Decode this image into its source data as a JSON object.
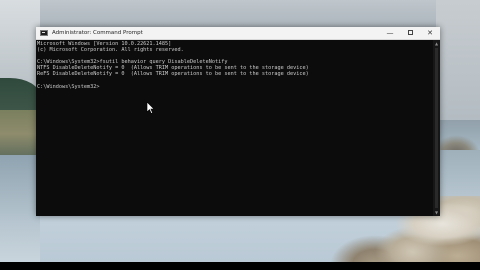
{
  "window": {
    "title": "Administrator: Command Prompt",
    "app_icon": "command-prompt-icon",
    "controls": {
      "minimize": "—",
      "close": "✕"
    }
  },
  "console": {
    "lines": [
      "Microsoft Windows [Version 10.0.22621.1485]",
      "(c) Microsoft Corporation. All rights reserved.",
      "",
      "C:\\Windows\\System32>fsutil behavior query DisableDeleteNotify",
      "NTFS DisableDeleteNotify = 0  (Allows TRIM operations to be sent to the storage device)",
      "ReFS DisableDeleteNotify = 0  (Allows TRIM operations to be sent to the storage device)",
      "",
      "C:\\Windows\\System32>"
    ],
    "text_color": "#cccccc",
    "background_color": "#0c0c0c"
  },
  "scrollbar": {
    "up_arrow": "▲",
    "down_arrow": "▼"
  }
}
